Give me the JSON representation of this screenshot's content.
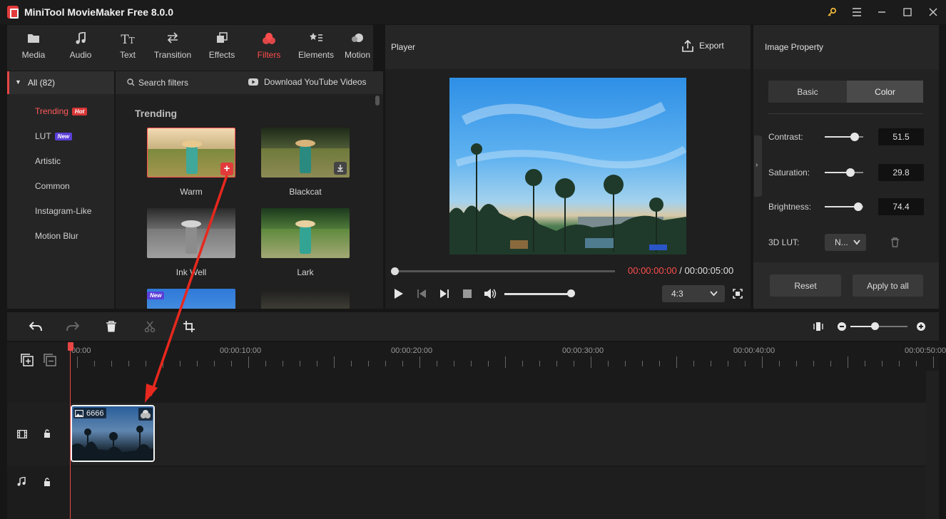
{
  "app": {
    "title": "MiniTool MovieMaker Free 8.0.0"
  },
  "toolbar": {
    "items": [
      {
        "label": "Media",
        "icon": "folder-icon"
      },
      {
        "label": "Audio",
        "icon": "music-note-icon"
      },
      {
        "label": "Text",
        "icon": "text-icon"
      },
      {
        "label": "Transition",
        "icon": "transition-arrows-icon"
      },
      {
        "label": "Effects",
        "icon": "effects-icon"
      },
      {
        "label": "Filters",
        "icon": "filters-icon",
        "active": true
      },
      {
        "label": "Elements",
        "icon": "elements-icon"
      },
      {
        "label": "Motion",
        "icon": "motion-icon"
      }
    ]
  },
  "sidebar": {
    "all_label": "All (82)",
    "items": [
      {
        "label": "Trending",
        "badge": "Hot",
        "active": true
      },
      {
        "label": "LUT",
        "badge": "New"
      },
      {
        "label": "Artistic"
      },
      {
        "label": "Common"
      },
      {
        "label": "Instagram-Like"
      },
      {
        "label": "Motion Blur"
      }
    ]
  },
  "filters": {
    "search_placeholder": "Search filters",
    "download_label": "Download YouTube Videos",
    "section_title": "Trending",
    "items": [
      {
        "label": "Warm"
      },
      {
        "label": "Blackcat"
      },
      {
        "label": "Ink Well"
      },
      {
        "label": "Lark"
      }
    ],
    "new_badge": "New"
  },
  "player": {
    "title": "Player",
    "export_label": "Export",
    "current_time": "00:00:00:00",
    "separator": " / ",
    "total_time": "00:00:05:00",
    "aspect_ratio": "4:3"
  },
  "properties": {
    "title": "Image Property",
    "tabs": [
      {
        "label": "Basic"
      },
      {
        "label": "Color",
        "active": true
      }
    ],
    "contrast": {
      "label": "Contrast:",
      "value": "51.5"
    },
    "saturation": {
      "label": "Saturation:",
      "value": "29.8"
    },
    "brightness": {
      "label": "Brightness:",
      "value": "74.4"
    },
    "lut": {
      "label": "3D LUT:",
      "value": "N..."
    },
    "reset_label": "Reset",
    "apply_all_label": "Apply to all"
  },
  "timeline": {
    "ruler": [
      "00:00",
      "00:00:10:00",
      "00:00:20:00",
      "00:00:30:00",
      "00:00:40:00",
      "00:00:50:00"
    ],
    "clip_name": "6666"
  },
  "colors": {
    "accent": "#e84545",
    "background": "#161616",
    "panel": "#252525"
  }
}
